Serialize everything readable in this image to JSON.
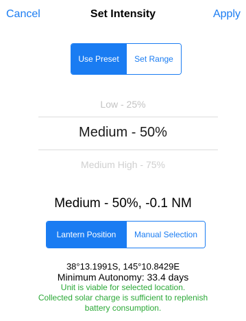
{
  "navbar": {
    "cancel_label": "Cancel",
    "title": "Set Intensity",
    "apply_label": "Apply"
  },
  "mode_segment": {
    "options": [
      "Use Preset",
      "Set Range"
    ],
    "selected": "Use Preset"
  },
  "picker": {
    "above": "Low - 25%",
    "selected": "Medium - 50%",
    "below": "Medium High - 75%"
  },
  "summary": "Medium - 50%, -0.1 NM",
  "position_segment": {
    "options": [
      "Lantern Position",
      "Manual Selection"
    ],
    "selected": "Lantern Position"
  },
  "info": {
    "coordinates": "38°13.1991S, 145°10.8429E",
    "autonomy": "Minimum Autonomy: 33.4 days",
    "viable": "Unit is viable for selected location.",
    "solar_line1": "Collected solar charge is sufficient to replenish",
    "solar_line2": "battery consumption."
  },
  "colors": {
    "accent": "#1a7cf2",
    "success": "#2aa836"
  }
}
